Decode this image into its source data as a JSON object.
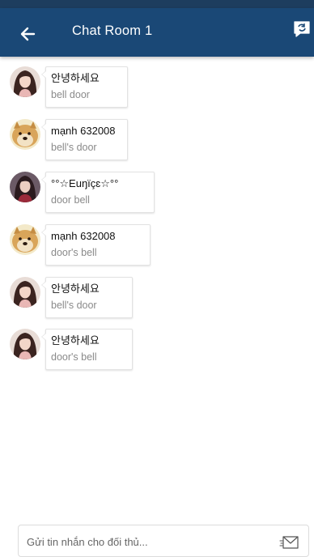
{
  "header": {
    "title": "Chat Room 1",
    "back_icon": "arrow-left-icon",
    "refresh_icon": "refresh-icon",
    "background": "#1a4876"
  },
  "messages": [
    {
      "sender": "안녕하세요",
      "text": "bell door",
      "avatar": "girl"
    },
    {
      "sender": "mạnh 632008",
      "text": "bell's door",
      "avatar": "doge"
    },
    {
      "sender": "°°☆Euŋïçɛ☆°°",
      "text": "door bell",
      "avatar": "girl2"
    },
    {
      "sender": "mạnh 632008",
      "text": " door's bell",
      "avatar": "doge"
    },
    {
      "sender": "안녕하세요",
      "text": "bell's door",
      "avatar": "girl"
    },
    {
      "sender": "안녕하세요",
      "text": "door's bell",
      "avatar": "girl"
    }
  ],
  "composer": {
    "placeholder": "Gửi tin nhắn cho đối thủ...",
    "value": "",
    "send_icon": "send-icon"
  }
}
